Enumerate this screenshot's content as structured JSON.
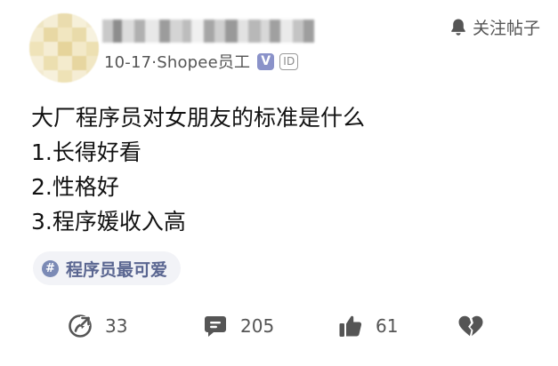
{
  "header": {
    "meta_text": "10-17·Shopee员工",
    "verified_mark": "V",
    "id_badge": "ID",
    "follow_label": "关注帖子",
    "follow_icon": "bell-icon"
  },
  "post": {
    "lines": [
      "大厂程序员对女朋友的标准是什么",
      "1.长得好看",
      "2.性格好",
      "3.程序媛收入高"
    ],
    "tag": {
      "icon_text": "#",
      "label": "程序员最可爱"
    }
  },
  "actions": {
    "share": {
      "icon": "share-icon",
      "count": "33"
    },
    "comment": {
      "icon": "comment-icon",
      "count": "205"
    },
    "like": {
      "icon": "thumbs-up-icon",
      "count": "61"
    },
    "dislike": {
      "icon": "broken-heart-icon"
    }
  },
  "colors": {
    "icon_gray": "#555555",
    "tag_bg": "#f2f3f7",
    "tag_text": "#5a6691",
    "verified_badge": "#8a92c9"
  }
}
